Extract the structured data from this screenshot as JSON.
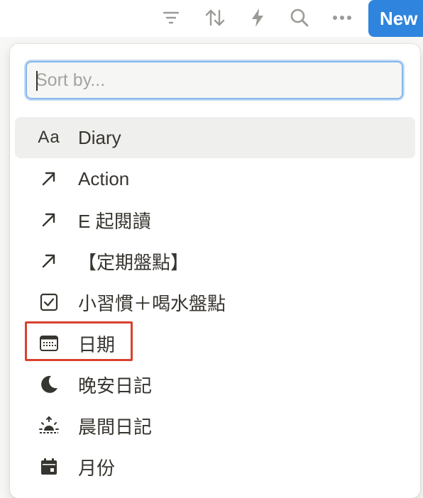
{
  "toolbar": {
    "icons": [
      "filter-icon",
      "sort-icon",
      "lightning-icon",
      "search-icon",
      "more-icon"
    ],
    "new_label": "New"
  },
  "search": {
    "placeholder": "Sort by...",
    "value": ""
  },
  "properties": [
    {
      "label": "Diary",
      "icon": "text-icon",
      "icon_text": "Aa"
    },
    {
      "label": "Action",
      "icon": "relation-arrow-icon"
    },
    {
      "label": "E 起閱讀",
      "icon": "relation-arrow-icon"
    },
    {
      "label": "【定期盤點】",
      "icon": "relation-arrow-icon"
    },
    {
      "label": "小習慣＋喝水盤點",
      "icon": "checkbox-icon"
    },
    {
      "label": "日期",
      "icon": "calendar-icon"
    },
    {
      "label": "晚安日記",
      "icon": "moon-icon"
    },
    {
      "label": "晨間日記",
      "icon": "sunrise-icon"
    },
    {
      "label": "月份",
      "icon": "calendar-month-icon"
    }
  ],
  "colors": {
    "accent": "#2f84de",
    "highlight_box": "#d9412f",
    "focus_ring": "#85b7ec"
  }
}
